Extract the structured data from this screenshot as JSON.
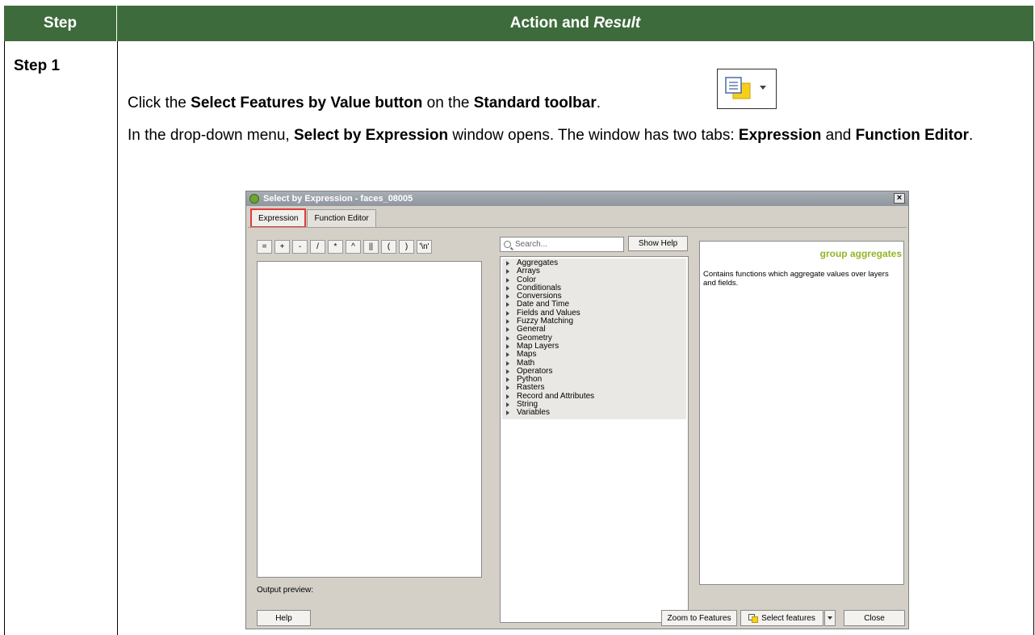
{
  "table": {
    "header_step": "Step",
    "header_action": "Action and ",
    "header_result": "Result"
  },
  "row1": {
    "step_label": "Step 1",
    "p1_text_a": "Click the ",
    "p1_bold_a": "Select Features by Value button",
    "p1_text_b": " on the ",
    "p1_bold_b": "Standard toolbar",
    "p1_text_c": ".",
    "p2_text_a": "In the drop-down menu, ",
    "p2_bold_a": "Select by Expression",
    "p2_text_b": " window opens. The window has two tabs: ",
    "p2_bold_b": "Expression",
    "p2_text_c": " and ",
    "p2_bold_c": "Function Editor",
    "p2_text_d": "."
  },
  "dialog": {
    "title": "Select by Expression - faces_08005",
    "close_glyph": "×",
    "tabs": [
      "Expression",
      "Function Editor"
    ],
    "operators": [
      "=",
      "+",
      "-",
      "/",
      "*",
      "^",
      "||",
      "(",
      ")",
      "'\\n'"
    ],
    "search_placeholder": "Search...",
    "show_help": "Show Help",
    "functions": [
      "Aggregates",
      "Arrays",
      "Color",
      "Conditionals",
      "Conversions",
      "Date and Time",
      "Fields and Values",
      "Fuzzy Matching",
      "General",
      "Geometry",
      "Map Layers",
      "Maps",
      "Math",
      "Operators",
      "Python",
      "Rasters",
      "Record and Attributes",
      "String",
      "Variables"
    ],
    "help_title": "group aggregates",
    "help_body": "Contains functions which aggregate values over layers and fields.",
    "output_preview": "Output preview:",
    "btn_help": "Help",
    "btn_zoom": "Zoom to Features",
    "btn_select": "Select features",
    "btn_close": "Close"
  }
}
